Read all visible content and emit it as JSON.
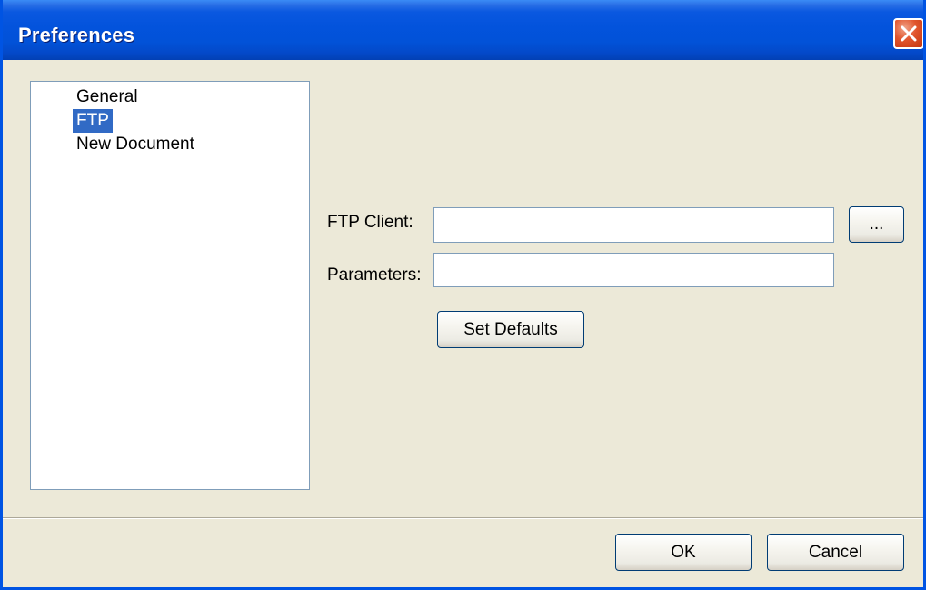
{
  "window": {
    "title": "Preferences"
  },
  "tree": {
    "items": [
      {
        "label": "General",
        "selected": false
      },
      {
        "label": "FTP",
        "selected": true
      },
      {
        "label": "New Document",
        "selected": false
      }
    ]
  },
  "ftp": {
    "client_label": "FTP Client:",
    "client_value": "",
    "browse_label": "...",
    "parameters_label": "Parameters:",
    "parameters_value": "",
    "set_defaults_label": "Set Defaults"
  },
  "footer": {
    "ok_label": "OK",
    "cancel_label": "Cancel"
  },
  "colors": {
    "titlebar": "#0353dc",
    "window_bg": "#ece9d8",
    "selection": "#316ac5",
    "close_button": "#e1552d"
  },
  "icons": {
    "close": "close-icon"
  }
}
